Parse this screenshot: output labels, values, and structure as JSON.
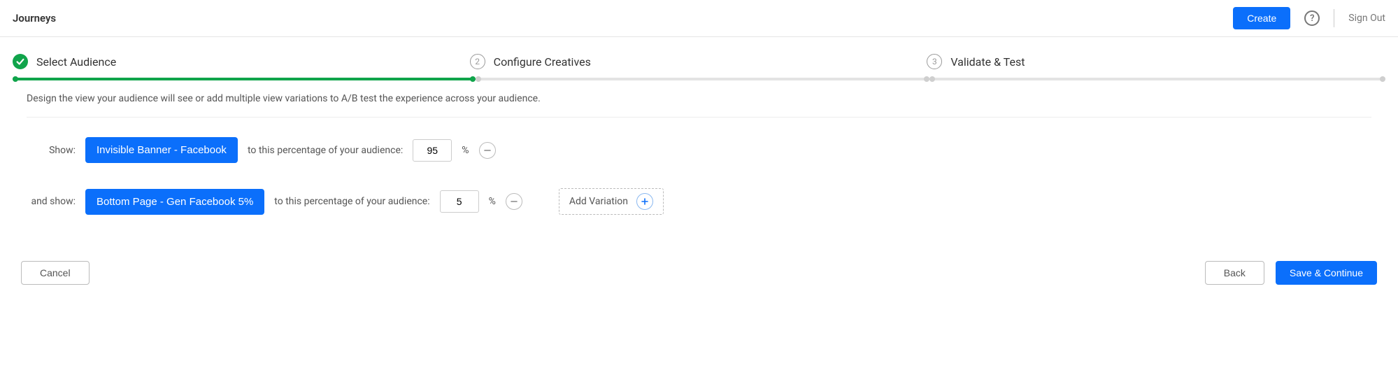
{
  "header": {
    "title": "Journeys",
    "create_label": "Create",
    "sign_out_label": "Sign Out",
    "help_glyph": "?"
  },
  "steps": {
    "s1": {
      "label": "Select Audience",
      "status": "complete"
    },
    "s2": {
      "label": "Configure Creatives",
      "number": "2"
    },
    "s3": {
      "label": "Validate & Test",
      "number": "3"
    }
  },
  "intro_text": "Design the view your audience will see or add multiple view variations to A/B test the experience across your audience.",
  "rows": {
    "r1": {
      "prefix": "Show:",
      "pill": "Invisible Banner - Facebook",
      "mid": "to this percentage of your audience:",
      "value": "95",
      "pct": "%"
    },
    "r2": {
      "prefix": "and show:",
      "pill": "Bottom Page - Gen Facebook 5%",
      "mid": "to this percentage of your audience:",
      "value": "5",
      "pct": "%"
    }
  },
  "add_variation_label": "Add Variation",
  "footer": {
    "cancel": "Cancel",
    "back": "Back",
    "save_continue": "Save & Continue"
  }
}
